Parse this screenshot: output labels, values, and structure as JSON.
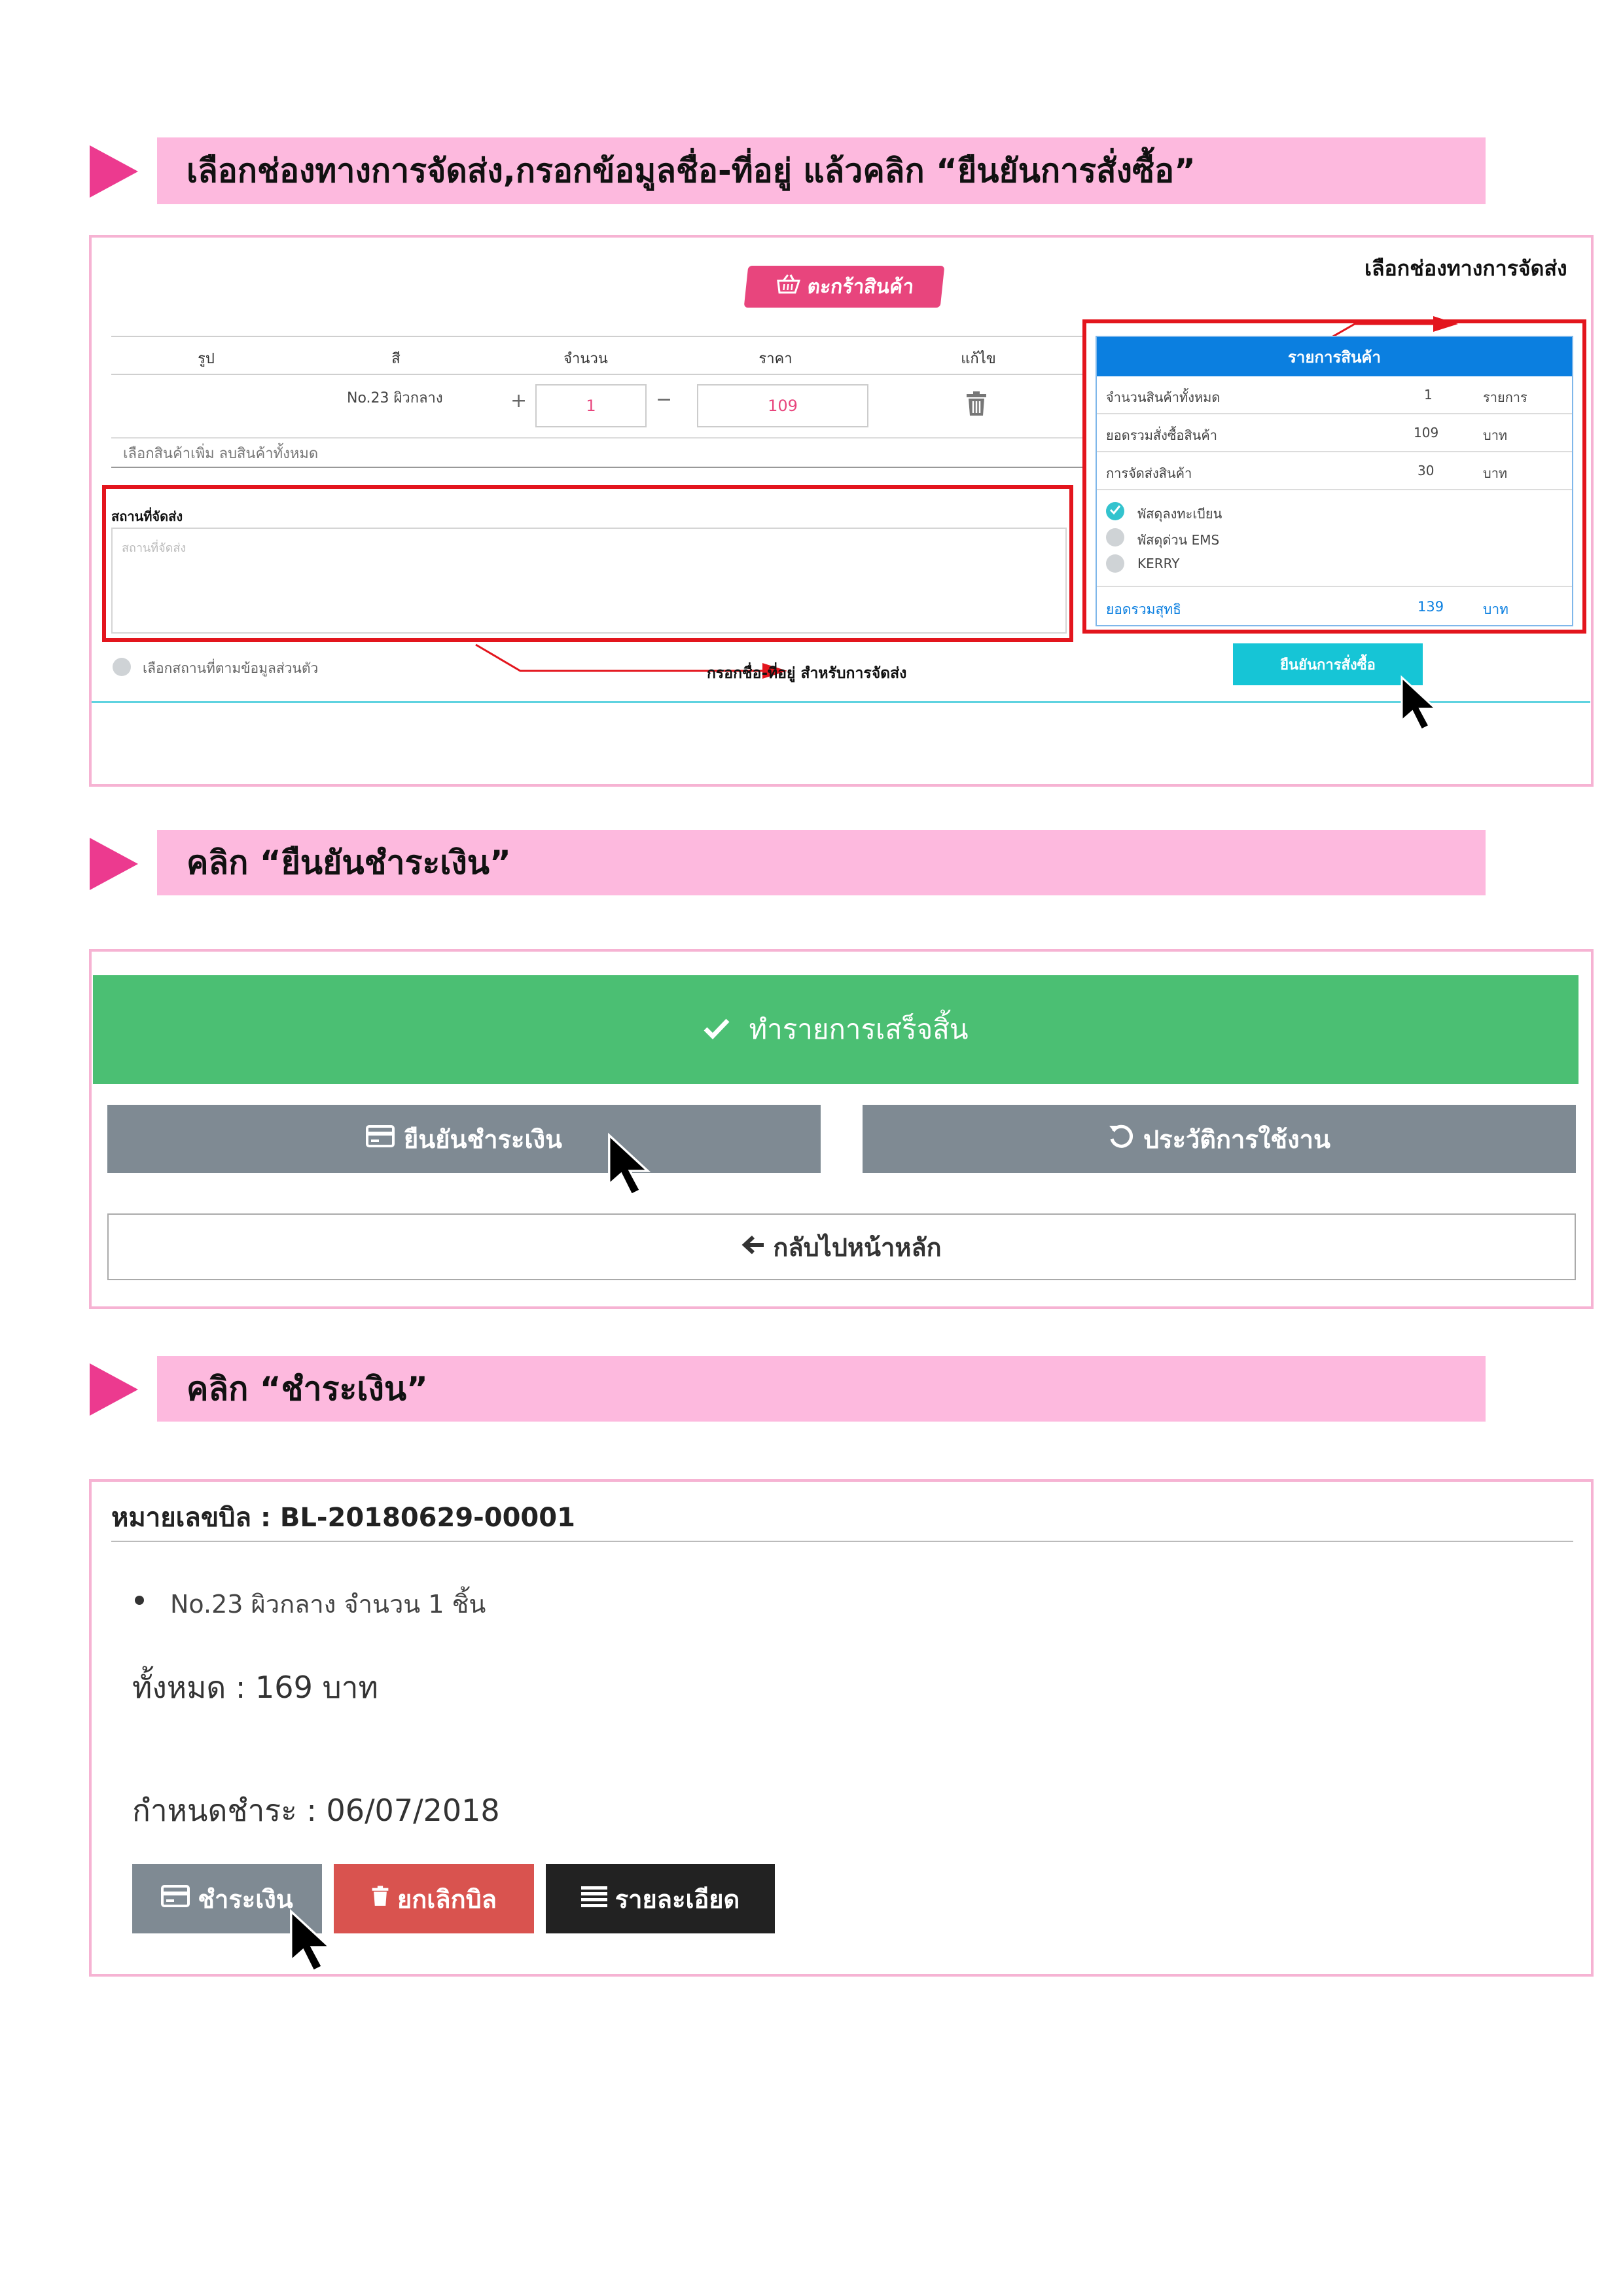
{
  "colors": {
    "accent_pink": "#ec3a8f",
    "banner_pink": "#fdb9de",
    "red_outline": "#e3151d",
    "summary_blue": "#0b7fe0",
    "cyan": "#16c5d6",
    "green": "#4bbf73",
    "grey_btn": "#7f8a93",
    "danger": "#d9534f",
    "dark_btn": "#222222"
  },
  "step1": {
    "banner": "เลือกช่องทางการจัดส่ง,กรอกข้อมูลชื่อ-ที่อยู่ แล้วคลิก “ยืนยันการสั่งซื้อ”",
    "annotation_shipping": "เลือกช่องทางการจัดส่ง",
    "annotation_address": "กรอกชื่อ-ที่อยู่ สำหรับการจัดส่ง",
    "cart_badge": "ตะกร้าสินค้า",
    "cart_badge_icon": "basket-icon",
    "table_headers": [
      "รูป",
      "สี",
      "จำนวน",
      "ราคา",
      "แก้ไข"
    ],
    "item": {
      "color": "No.23 ผิวกลาง",
      "qty": "1",
      "price": "109",
      "plus": "+",
      "minus": "−"
    },
    "cart_links": "เลือกสินค้าเพิ่ม ลบสินค้าทั้งหมด",
    "address_label": "สถานที่จัดส่ง",
    "address_placeholder": "สถานที่จัดส่ง",
    "use_profile": "เลือกสถานที่ตามข้อมูลส่วนตัว",
    "summary": {
      "title": "รายการสินค้า",
      "rows": [
        {
          "label": "จำนวนสินค้าทั้งหมด",
          "value": "1",
          "unit": "รายการ"
        },
        {
          "label": "ยอดรวมสั่งซื้อสินค้า",
          "value": "109",
          "unit": "บาท"
        },
        {
          "label": "การจัดส่งสินค้า",
          "value": "30",
          "unit": "บาท"
        }
      ],
      "shipping_options": [
        "พัสดุลงทะเบียน",
        "พัสดุด่วน EMS",
        "KERRY"
      ],
      "total_label": "ยอดรวมสุทธิ",
      "total_value": "139",
      "total_unit": "บาท"
    },
    "confirm_button": "ยืนยันการสั่งซื้อ"
  },
  "step2": {
    "banner": "คลิก “ยืนยันชำระเงิน”",
    "success": "ทำรายการเสร็จสิ้น",
    "pay_confirm": "ยืนยันชำระเงิน",
    "history": "ประวัติการใช้งาน",
    "back_home": "กลับไปหน้าหลัก"
  },
  "step3": {
    "banner": "คลิก “ชำระเงิน”",
    "bill_no": "หมายเลขบิล : BL-20180629-00001",
    "item_line": "No.23 ผิวกลาง จำนวน 1 ชิ้น",
    "total": "ทั้งหมด : 169 บาท",
    "due": "กำหนดชำระ : 06/07/2018",
    "pay": "ชำระเงิน",
    "cancel": "ยกเลิกบิล",
    "details": "รายละเอียด"
  }
}
